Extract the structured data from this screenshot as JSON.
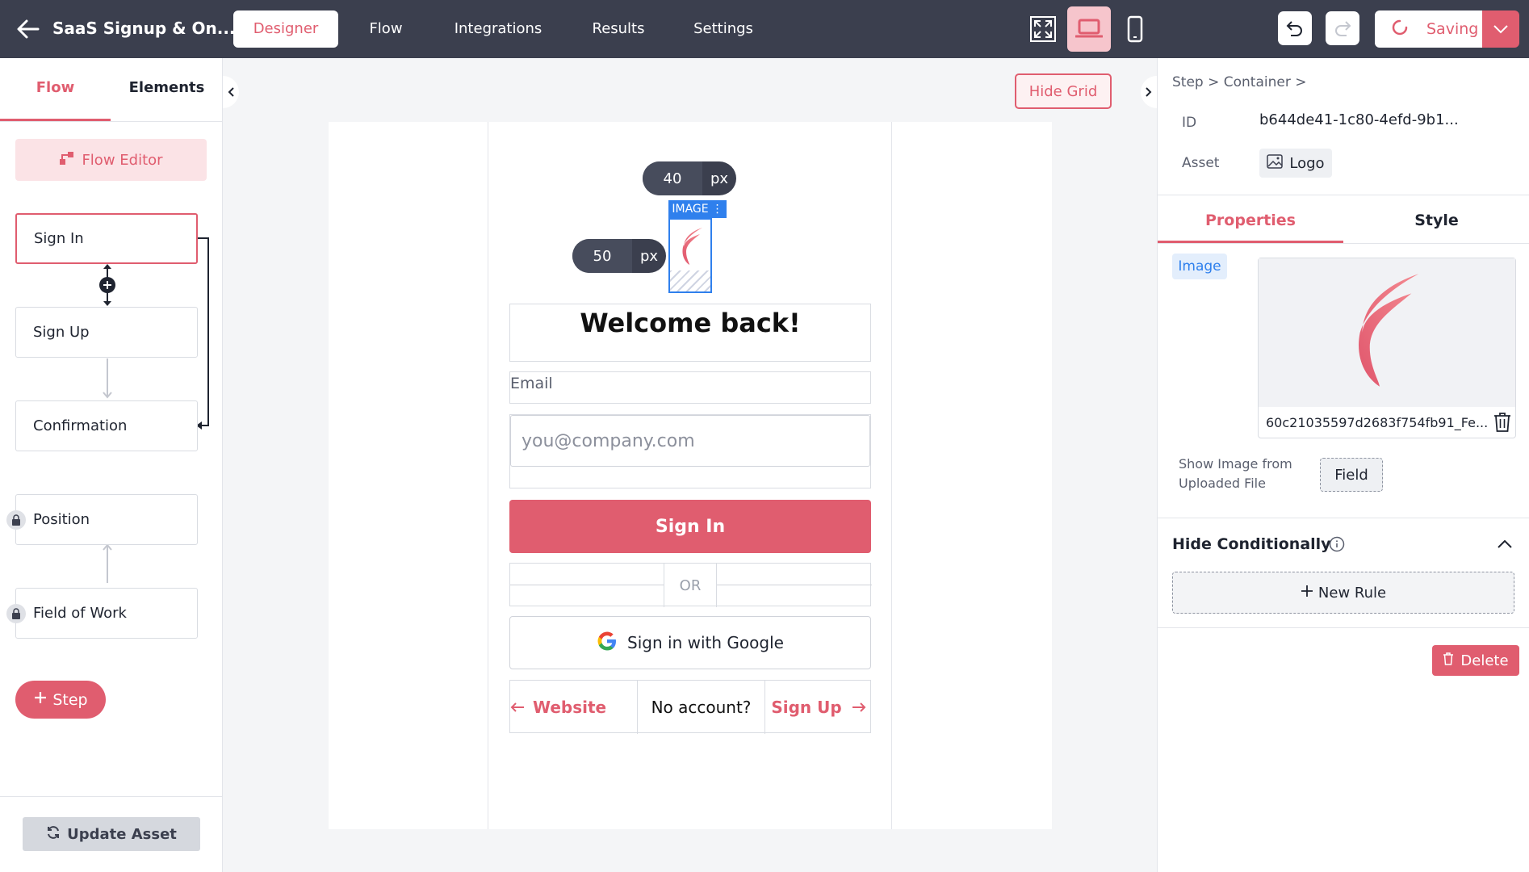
{
  "header": {
    "title": "SaaS Signup & On...",
    "tabs": [
      {
        "label": "Designer",
        "active": true
      },
      {
        "label": "Flow"
      },
      {
        "label": "Integrations"
      },
      {
        "label": "Results"
      },
      {
        "label": "Settings"
      }
    ],
    "devices": [
      "fullscreen-icon",
      "laptop-icon",
      "mobile-icon"
    ],
    "active_device": "laptop",
    "saving_label": "Saving"
  },
  "left_panel": {
    "tabs": [
      {
        "label": "Flow",
        "active": true
      },
      {
        "label": "Elements"
      }
    ],
    "flow_editor_label": "Flow Editor",
    "steps": [
      {
        "label": "Sign In",
        "active": true,
        "locked": false
      },
      {
        "label": "Sign Up",
        "locked": false
      },
      {
        "label": "Confirmation",
        "locked": false
      },
      {
        "label": "Position",
        "locked": true
      },
      {
        "label": "Field of Work",
        "locked": true
      }
    ],
    "add_step_label": "Step",
    "update_asset_label": "Update Asset"
  },
  "canvas": {
    "hide_grid_label": "Hide Grid",
    "width_pill": {
      "value": "40",
      "unit": "px"
    },
    "height_pill": {
      "value": "50",
      "unit": "px"
    },
    "image_tag": "IMAGE",
    "welcome": "Welcome back!",
    "email_label": "Email",
    "email_placeholder": "you@company.com",
    "signin_label": "Sign In",
    "or_label": "OR",
    "google_label": "Sign in with Google",
    "website_label": "Website",
    "no_account_label": "No account?",
    "signup_label": "Sign Up"
  },
  "right_panel": {
    "breadcrumb": "Step  >  Container  >",
    "id_key": "ID",
    "id_value": "b644de41-1c80-4efd-9b1...",
    "asset_key": "Asset",
    "asset_value": "Logo",
    "tabs": [
      {
        "label": "Properties",
        "active": true
      },
      {
        "label": "Style"
      }
    ],
    "image_badge": "Image",
    "file_name": "60c21035597d2683f754fb91_Fe...",
    "show_from_label": "Show Image from Uploaded File",
    "field_label": "Field",
    "hide_conditionally_label": "Hide Conditionally",
    "new_rule_label": "New Rule",
    "delete_label": "Delete"
  },
  "colors": {
    "accent": "#e05d6f",
    "topbar": "#3b3f4e",
    "selection": "#2f80ed"
  }
}
